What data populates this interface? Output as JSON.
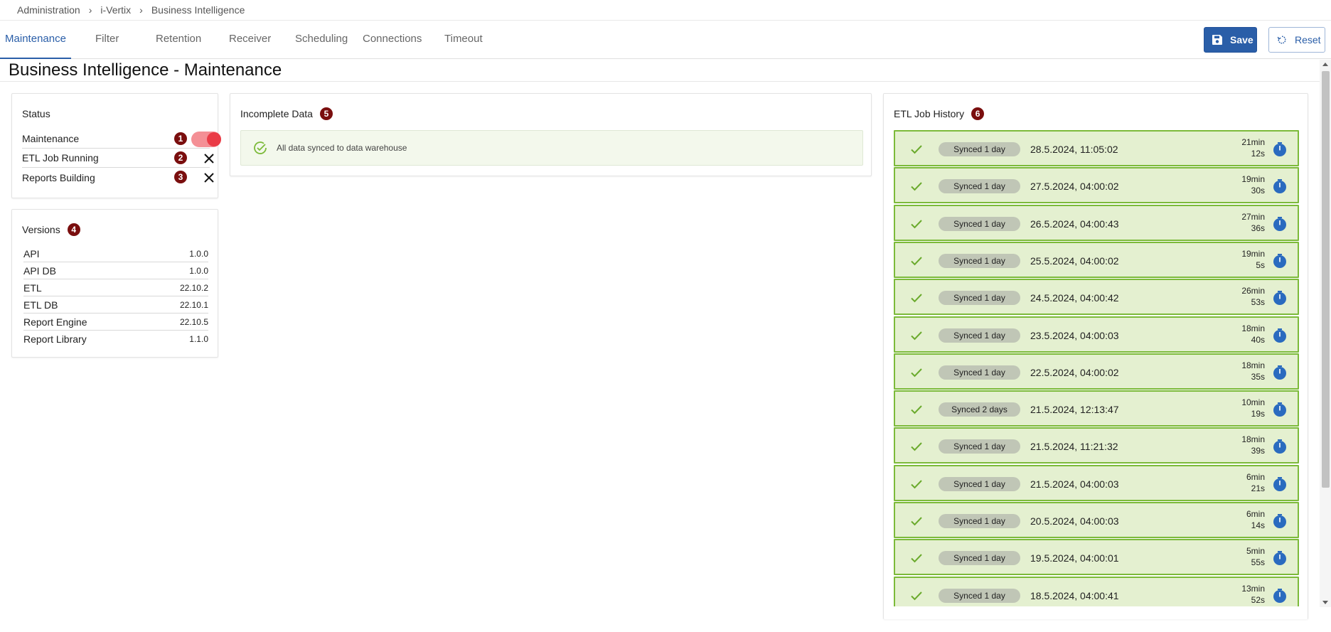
{
  "breadcrumb": [
    "Administration",
    "i-Vertix",
    "Business Intelligence"
  ],
  "tabs": [
    {
      "label": "Maintenance",
      "active": true
    },
    {
      "label": "Filter"
    },
    {
      "label": "Retention"
    },
    {
      "label": "Receiver"
    },
    {
      "label": "Scheduling"
    },
    {
      "label": "Connections"
    },
    {
      "label": "Timeout"
    }
  ],
  "toolbar": {
    "save_label": "Save",
    "reset_label": "Reset"
  },
  "page": {
    "title": "Business Intelligence - Maintenance"
  },
  "status": {
    "title": "Status",
    "rows": [
      {
        "label": "Maintenance",
        "badge": "1",
        "state": "on",
        "control": "toggle"
      },
      {
        "label": "ETL Job Running",
        "badge": "2",
        "state": "off",
        "control": "x-icon"
      },
      {
        "label": "Reports Building",
        "badge": "3",
        "state": "off",
        "control": "x-icon"
      }
    ]
  },
  "versions": {
    "title": "Versions",
    "badge": "4",
    "rows": [
      {
        "name": "API",
        "version": "1.0.0"
      },
      {
        "name": "API DB",
        "version": "1.0.0"
      },
      {
        "name": "ETL",
        "version": "22.10.2"
      },
      {
        "name": "ETL DB",
        "version": "22.10.1"
      },
      {
        "name": "Report Engine",
        "version": "22.10.5"
      },
      {
        "name": "Report Library",
        "version": "1.1.0"
      }
    ]
  },
  "incomplete": {
    "title": "Incomplete Data",
    "badge": "5",
    "message": "All data synced to data warehouse"
  },
  "etl_history": {
    "title": "ETL Job History",
    "badge": "6",
    "jobs": [
      {
        "status": "Synced 1 day",
        "date": "28.5.2024, 11:05:02",
        "dur_min": "21min",
        "dur_sec": "12s"
      },
      {
        "status": "Synced 1 day",
        "date": "27.5.2024, 04:00:02",
        "dur_min": "19min",
        "dur_sec": "30s"
      },
      {
        "status": "Synced 1 day",
        "date": "26.5.2024, 04:00:43",
        "dur_min": "27min",
        "dur_sec": "36s"
      },
      {
        "status": "Synced 1 day",
        "date": "25.5.2024, 04:00:02",
        "dur_min": "19min",
        "dur_sec": "5s"
      },
      {
        "status": "Synced 1 day",
        "date": "24.5.2024, 04:00:42",
        "dur_min": "26min",
        "dur_sec": "53s"
      },
      {
        "status": "Synced 1 day",
        "date": "23.5.2024, 04:00:03",
        "dur_min": "18min",
        "dur_sec": "40s"
      },
      {
        "status": "Synced 1 day",
        "date": "22.5.2024, 04:00:02",
        "dur_min": "18min",
        "dur_sec": "35s"
      },
      {
        "status": "Synced 2 days",
        "date": "21.5.2024, 12:13:47",
        "dur_min": "10min",
        "dur_sec": "19s"
      },
      {
        "status": "Synced 1 day",
        "date": "21.5.2024, 11:21:32",
        "dur_min": "18min",
        "dur_sec": "39s"
      },
      {
        "status": "Synced 1 day",
        "date": "21.5.2024, 04:00:03",
        "dur_min": "6min",
        "dur_sec": "21s"
      },
      {
        "status": "Synced 1 day",
        "date": "20.5.2024, 04:00:03",
        "dur_min": "6min",
        "dur_sec": "14s"
      },
      {
        "status": "Synced 1 day",
        "date": "19.5.2024, 04:00:01",
        "dur_min": "5min",
        "dur_sec": "55s"
      },
      {
        "status": "Synced 1 day",
        "date": "18.5.2024, 04:00:41",
        "dur_min": "13min",
        "dur_sec": "52s"
      }
    ]
  },
  "colors": {
    "accent": "#2a5ea8",
    "badge": "#7a0e0e",
    "success_bg": "#e4f0d0",
    "success_border": "#7cba3a",
    "toggle_on": "#ea3b46"
  }
}
